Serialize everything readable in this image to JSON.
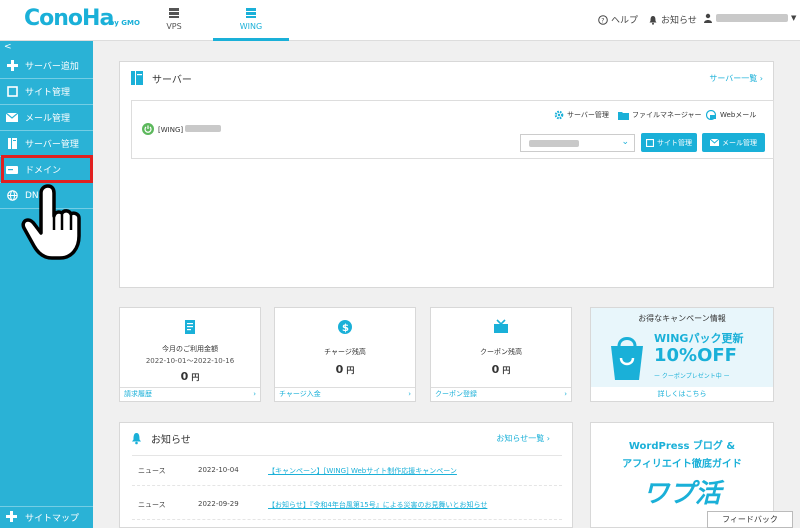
{
  "header": {
    "logo_text": "ConoHa",
    "logo_sub": "by GMO",
    "tabs": [
      {
        "label": "VPS",
        "icon": "server-icon"
      },
      {
        "label": "WING",
        "icon": "server-icon"
      }
    ],
    "help_label": "ヘルプ",
    "notice_label": "お知らせ",
    "accent_color": "#1ab0d8"
  },
  "sidebar": {
    "collapse_glyph": "<",
    "items": [
      {
        "label": "サーバー追加",
        "icon": "plus-icon"
      },
      {
        "label": "サイト管理",
        "icon": "window-icon"
      },
      {
        "label": "メール管理",
        "icon": "envelope-icon"
      },
      {
        "label": "サーバー管理",
        "icon": "server-icon"
      },
      {
        "label": "ドメイン",
        "icon": "domain-icon"
      },
      {
        "label": "DNS",
        "icon": "globe-icon"
      }
    ],
    "sitemap_label": "サイトマップ"
  },
  "server_panel": {
    "title": "サーバー",
    "list_link": "サーバー一覧",
    "server_prefix": "[WING]",
    "tools": {
      "server_manage": "サーバー管理",
      "file_manager": "ファイルマネージャー",
      "webmail": "Webメール"
    },
    "site_button": "サイト管理",
    "mail_button": "メール管理"
  },
  "cards": [
    {
      "label": "今月のご利用金額",
      "date": "2022-10-01〜2022-10-16",
      "value": "0",
      "unit": "円",
      "footer": "請求履歴"
    },
    {
      "label": "チャージ残高",
      "date": "",
      "value": "0",
      "unit": "円",
      "footer": "チャージ入金"
    },
    {
      "label": "クーポン残高",
      "date": "",
      "value": "0",
      "unit": "円",
      "footer": "クーポン登録"
    }
  ],
  "campaign": {
    "heading": "お得なキャンペーン情報",
    "line1": "WINGパック更新",
    "line2": "10%OFF",
    "line3": "ー クーポンプレゼント中 ー",
    "more": "詳しくはこちら"
  },
  "news": {
    "title": "お知らせ",
    "list_link": "お知らせ一覧",
    "items": [
      {
        "category": "ニュース",
        "date": "2022-10-04",
        "title": "【キャンペーン】[WING] Webサイト制作応援キャンペーン"
      },
      {
        "category": "ニュース",
        "date": "2022-09-29",
        "title": "【お知らせ】『令和4年台風第15号』による災害のお見舞いとお知らせ"
      }
    ]
  },
  "wp_banner": {
    "line1": "WordPress ブログ &",
    "line2": "アフィリエイト徹底ガイド",
    "line3": "ワプ活"
  },
  "feedback_label": "フィードバック"
}
